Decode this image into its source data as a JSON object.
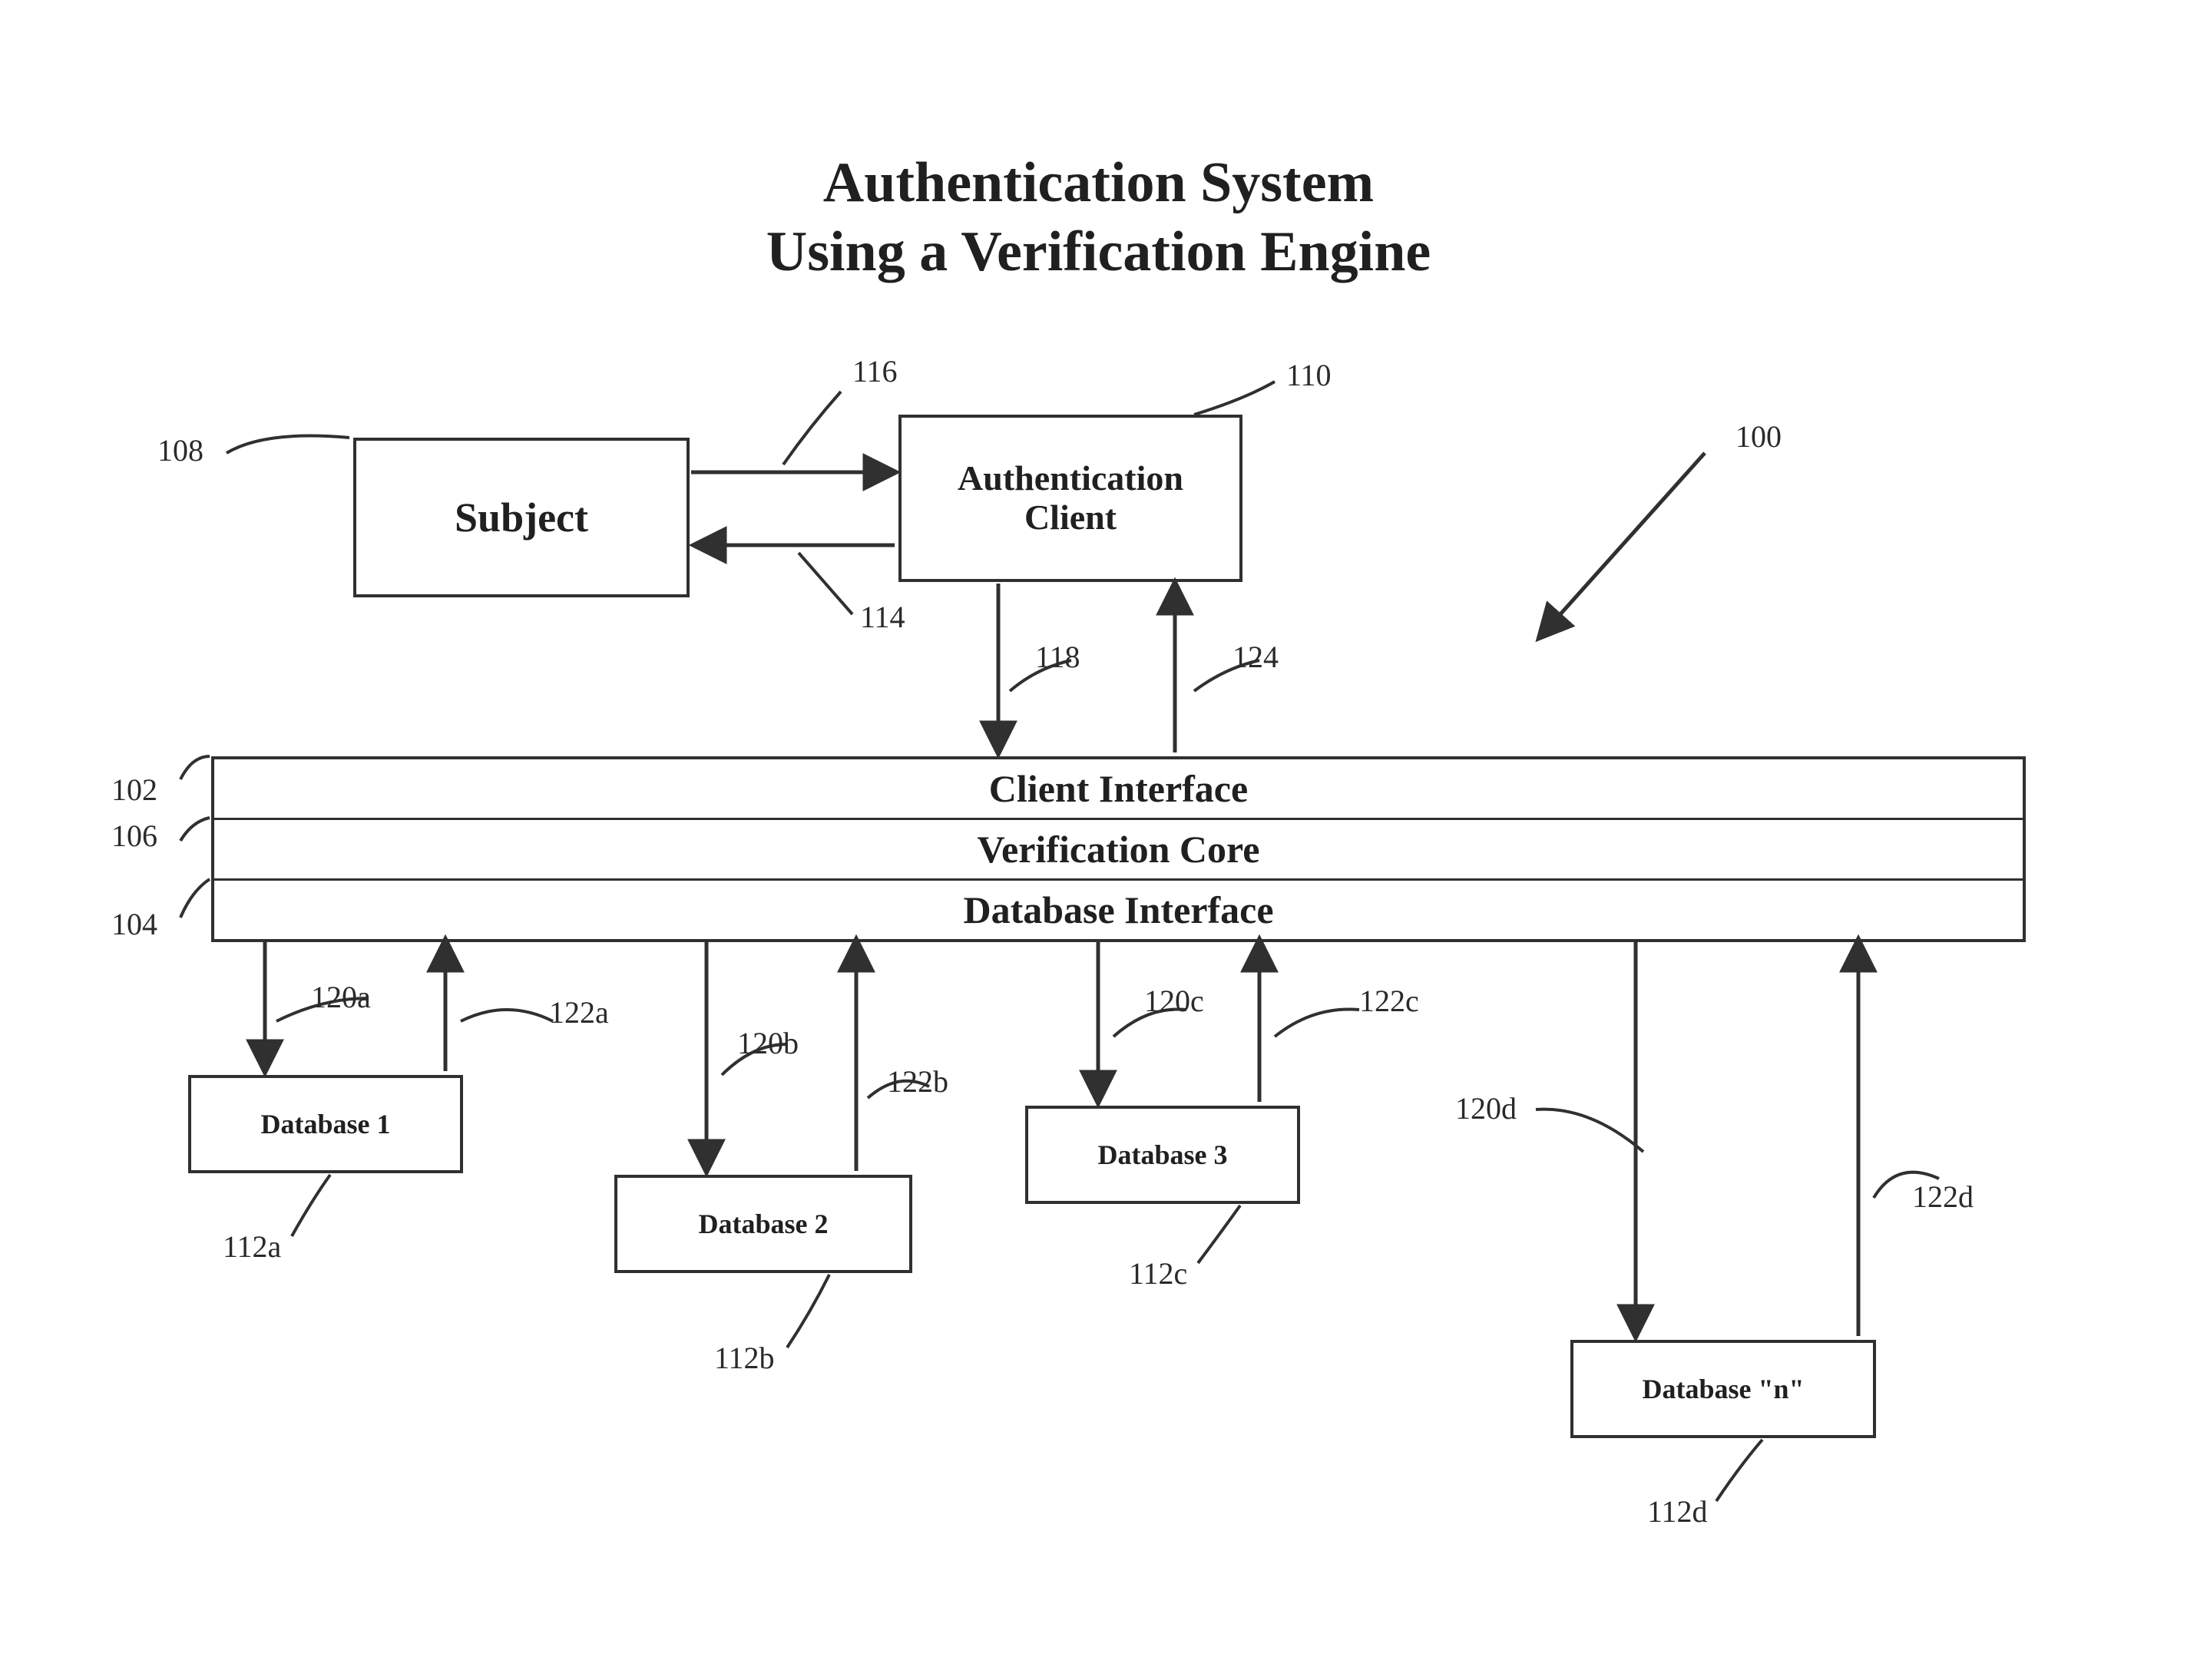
{
  "title": {
    "line1": "Authentication System",
    "line2": "Using a Verification Engine"
  },
  "blocks": {
    "subject": "Subject",
    "authclient_line1": "Authentication",
    "authclient_line2": "Client"
  },
  "layers": {
    "client_interface": "Client Interface",
    "verification_core": "Verification Core",
    "database_interface": "Database Interface"
  },
  "databases": {
    "db1": "Database 1",
    "db2": "Database 2",
    "db3": "Database 3",
    "dbn": "Database \"n\""
  },
  "refs": {
    "r100": "100",
    "r102": "102",
    "r104": "104",
    "r106": "106",
    "r108": "108",
    "r110": "110",
    "r112a": "112a",
    "r112b": "112b",
    "r112c": "112c",
    "r112d": "112d",
    "r114": "114",
    "r116": "116",
    "r118": "118",
    "r120a": "120a",
    "r120b": "120b",
    "r120c": "120c",
    "r120d": "120d",
    "r122a": "122a",
    "r122b": "122b",
    "r122c": "122c",
    "r122d": "122d",
    "r124": "124"
  }
}
